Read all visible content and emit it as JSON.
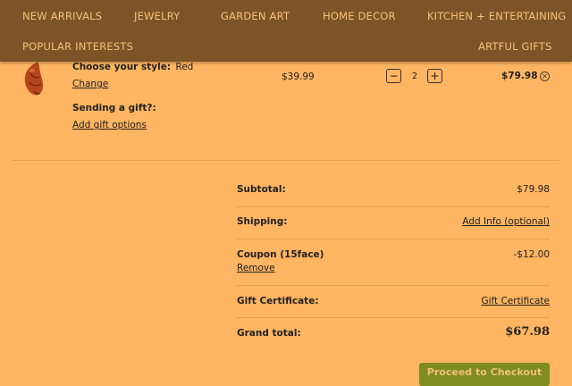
{
  "nav": {
    "items": [
      "NEW ARRIVALS",
      "JEWELRY",
      "GARDEN ART",
      "HOME DECOR",
      "KITCHEN + ENTERTAINING",
      "POPULAR INTERESTS",
      "ARTFUL GIFTS"
    ]
  },
  "item": {
    "style_label": "Choose your style:",
    "style_value": "Red",
    "change_link": "Change",
    "gift_label": "Sending a gift?:",
    "gift_link": "Add gift options",
    "price": "$39.99",
    "quantity": "2",
    "line_total": "$79.98"
  },
  "summary": {
    "subtotal_label": "Subtotal:",
    "subtotal_value": "$79.98",
    "shipping_label": "Shipping:",
    "shipping_value": "Add Info (optional)",
    "coupon_label": "Coupon (15face)",
    "coupon_remove": "Remove",
    "coupon_value": "-$12.00",
    "gift_cert_label": "Gift Certificate:",
    "gift_cert_value": "Gift Certificate",
    "grand_total_label": "Grand total:",
    "grand_total_value": "$67.98"
  },
  "checkout_label": "Proceed to Checkout",
  "colors": {
    "page_bg": "#ffb561",
    "nav_bg": "#7c5427",
    "nav_text": "#f6c27a",
    "checkout_bg": "#7e8d1f"
  }
}
